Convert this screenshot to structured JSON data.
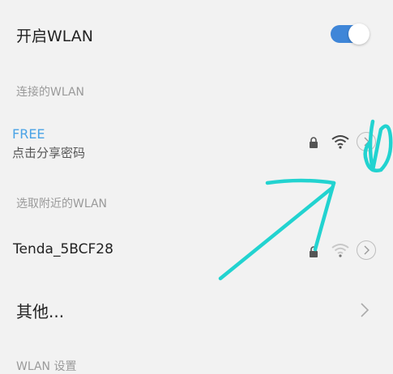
{
  "wlan_toggle": {
    "label": "开启WLAN",
    "on": true
  },
  "sections": {
    "connected": "连接的WLAN",
    "nearby": "选取附近的WLAN",
    "settings": "WLAN 设置"
  },
  "networks": [
    {
      "name": "FREE",
      "subtitle": "点击分享密码",
      "secured": true,
      "signal": "full",
      "connected": true
    },
    {
      "name": "Tenda_5BCF28",
      "secured": true,
      "signal": "weak",
      "connected": false
    }
  ],
  "other": {
    "label": "其他..."
  },
  "colors": {
    "accent": "#3f86d8",
    "connected_name": "#4aa3e6",
    "annotation": "#22d3d0"
  }
}
